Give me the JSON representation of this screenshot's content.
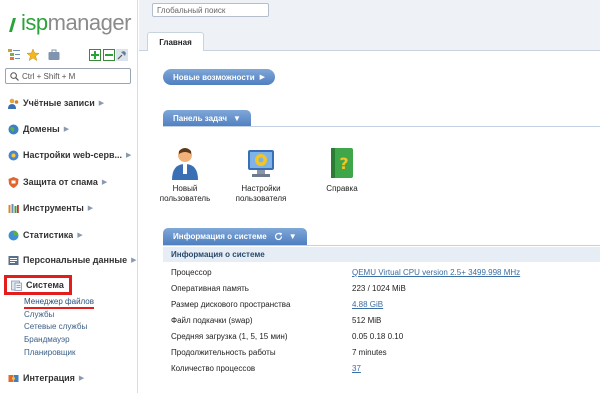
{
  "logo": {
    "part1": "isp",
    "part2": "manager"
  },
  "toolbar": {
    "icons": [
      "tree-icon",
      "star-icon",
      "briefcase-icon",
      "expand-icon",
      "collapse-icon",
      "pin-icon"
    ]
  },
  "sidebar_search": {
    "placeholder": "Ctrl + Shift + M"
  },
  "nav": [
    {
      "id": "accounts",
      "label": "Учётные записи",
      "icon": "users-icon"
    },
    {
      "id": "domains",
      "label": "Домены",
      "icon": "globe-icon"
    },
    {
      "id": "web-settings",
      "label": "Настройки web-серв...",
      "icon": "web-settings-icon"
    },
    {
      "id": "spam",
      "label": "Защита от спама",
      "icon": "shield-icon"
    },
    {
      "id": "tools",
      "label": "Инструменты",
      "icon": "tools-icon"
    },
    {
      "id": "stats",
      "label": "Статистика",
      "icon": "chart-icon"
    },
    {
      "id": "personal",
      "label": "Персональные данные",
      "icon": "personal-data-icon"
    },
    {
      "id": "system",
      "label": "Система",
      "icon": "system-icon",
      "active": true
    },
    {
      "id": "integration",
      "label": "Интеграция",
      "icon": "integration-icon"
    }
  ],
  "system_subitems": [
    "Менеджер файлов",
    "Службы",
    "Сетевые службы",
    "Брандмауэр",
    "Планировщик"
  ],
  "global_search": {
    "placeholder": "Глобальный поиск"
  },
  "main_tab": "Главная",
  "news_button": "Новые возможности",
  "tasks_panel": {
    "title": "Панель задач",
    "items": [
      {
        "icon": "new-user-icon",
        "label": "Новый пользователь"
      },
      {
        "icon": "user-settings-icon",
        "label": "Настройки пользователя"
      },
      {
        "icon": "help-book-icon",
        "label": "Справка"
      }
    ]
  },
  "system_info": {
    "title": "Информация о системе",
    "table_header": "Информация о системе",
    "rows": [
      {
        "key": "Процессор",
        "value": "QEMU Virtual CPU version 2.5+ 3499.998 MHz",
        "link": true
      },
      {
        "key": "Оперативная память",
        "value": "223 / 1024 MiB",
        "link": false
      },
      {
        "key": "Размер дискового пространства",
        "value": "4.88 GiB",
        "link": true
      },
      {
        "key": "Файл подкачки (swap)",
        "value": "512 MiB",
        "link": false
      },
      {
        "key": "Средняя загрузка (1, 5, 15 мин)",
        "value": "0.05 0.18 0.10",
        "link": false
      },
      {
        "key": "Продолжительность работы",
        "value": "7 minutes",
        "link": false
      },
      {
        "key": "Количество процессов",
        "value": "37",
        "link": true
      }
    ]
  },
  "colors": {
    "accent": "#4f7fc0",
    "highlight": "#e31c1c",
    "logo_green": "#2aa33a"
  }
}
